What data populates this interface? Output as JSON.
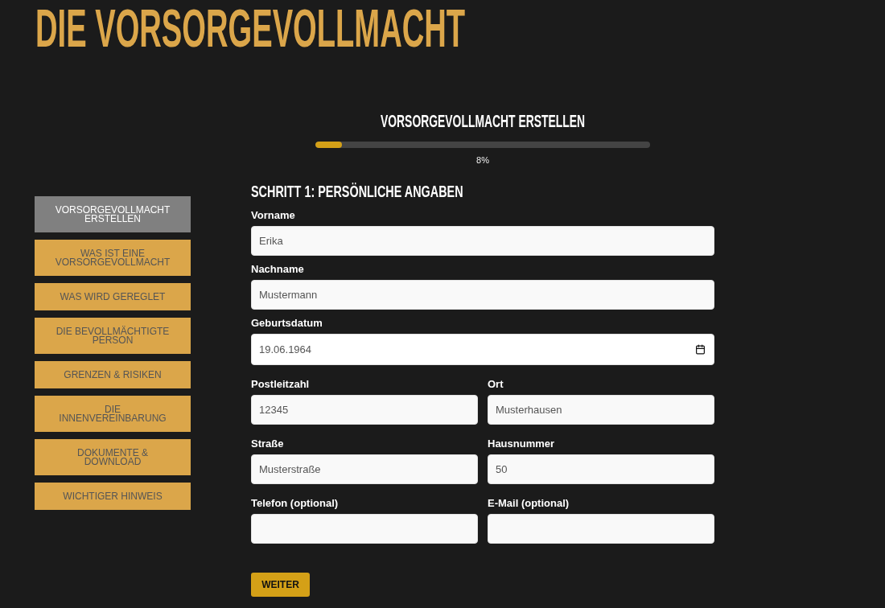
{
  "page": {
    "title": "DIE VORSORGEVOLLMACHT"
  },
  "sidebar": {
    "items": [
      {
        "label": "VORSORGEVOLLMACHT ERSTELLEN",
        "selected": true
      },
      {
        "label": "WAS IST EINE VORSORGEVOLLMACHT",
        "selected": false
      },
      {
        "label": "WAS WIRD GEREGLET",
        "selected": false
      },
      {
        "label": "DIE BEVOLLMÄCHTIGTE PERSON",
        "selected": false
      },
      {
        "label": "GRENZEN & RISIKEN",
        "selected": false
      },
      {
        "label": "DIE INNENVEREINBARUNG",
        "selected": false
      },
      {
        "label": "DOKUMENTE & DOWNLOAD",
        "selected": false
      },
      {
        "label": "WICHTIGER HINWEIS",
        "selected": false
      }
    ]
  },
  "wizard": {
    "title": "VORSORGEVOLLMACHT ERSTELLEN",
    "progress": {
      "level": 0.08,
      "reading": "8%"
    },
    "step_title": "SCHRITT 1: PERSÖNLICHE ANGABEN",
    "rows": [
      {
        "fields": [
          {
            "kind": "text",
            "label": "Vorname",
            "value": "Erika"
          }
        ]
      },
      {
        "fields": [
          {
            "kind": "text",
            "label": "Nachname",
            "value": "Mustermann"
          }
        ]
      },
      {
        "fields": [
          {
            "kind": "date",
            "label": "Geburtsdatum",
            "value": "19.06.1964"
          }
        ]
      },
      {
        "fields": [
          {
            "kind": "text",
            "label": "Postleitzahl",
            "value": "12345"
          },
          {
            "kind": "text",
            "label": "Ort",
            "value": "Musterhausen"
          }
        ]
      },
      {
        "fields": [
          {
            "kind": "text",
            "label": "Straße",
            "value": "Musterstraße"
          },
          {
            "kind": "text",
            "label": "Hausnummer",
            "value": "50"
          }
        ]
      },
      {
        "fields": [
          {
            "kind": "text",
            "label": "Telefon (optional)"
          },
          {
            "kind": "text",
            "label": "E-Mail (optional)"
          }
        ]
      }
    ],
    "button": "WEITER"
  }
}
